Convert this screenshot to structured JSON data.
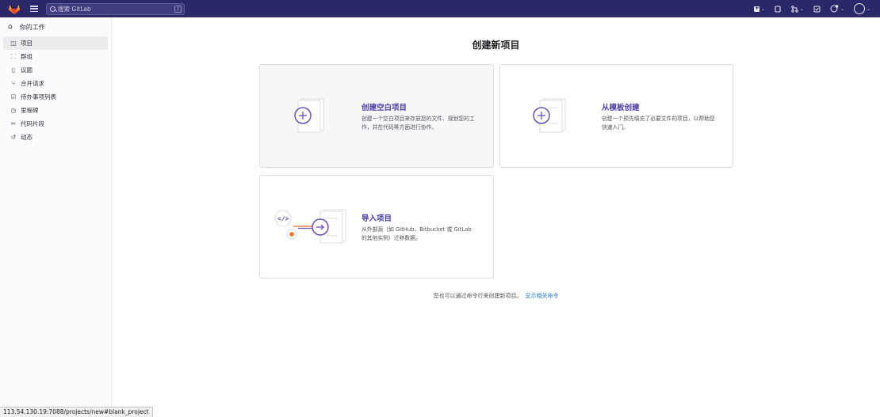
{
  "topbar": {
    "search_placeholder": "搜索 GitLab",
    "search_shortcut": "/",
    "icons": [
      "new-menu-icon",
      "issues-icon",
      "merge-requests-icon",
      "todo-icon",
      "help-icon",
      "avatar"
    ]
  },
  "sidebar": {
    "title": "你的工作",
    "items": [
      {
        "label": "项目",
        "icon": "project-icon"
      },
      {
        "label": "群组",
        "icon": "group-icon"
      },
      {
        "label": "议题",
        "icon": "issues-icon"
      },
      {
        "label": "合并请求",
        "icon": "merge-request-icon"
      },
      {
        "label": "待办事项列表",
        "icon": "todo-icon"
      },
      {
        "label": "里程碑",
        "icon": "milestone-icon"
      },
      {
        "label": "代码片段",
        "icon": "snippet-icon"
      },
      {
        "label": "动态",
        "icon": "activity-icon"
      }
    ]
  },
  "main": {
    "title": "创建新项目",
    "cards": [
      {
        "title": "创建空白项目",
        "desc1": "创建一个空白项目来存放您的文件、规划您的工",
        "desc2": "作，并在代码等方面进行协作。"
      },
      {
        "title": "从模板创建",
        "desc1": "创建一个预先填充了必要文件的项目，以帮助您",
        "desc2": "快速入门。"
      },
      {
        "title": "导入项目",
        "desc1": "从外部源（如 GitHub、Bitbucket 或 GitLab",
        "desc2": "的其他实例）迁移数据。"
      }
    ],
    "cmd_text": "您也可以通过命令行来创建新项目。",
    "cmd_link": "显示相关命令"
  },
  "status_url": "113.54.130.19:7088/projects/new#blank_project",
  "colors": {
    "topbar": "#2a2869",
    "accent": "#6b4fbb",
    "link": "#1f75cb"
  }
}
